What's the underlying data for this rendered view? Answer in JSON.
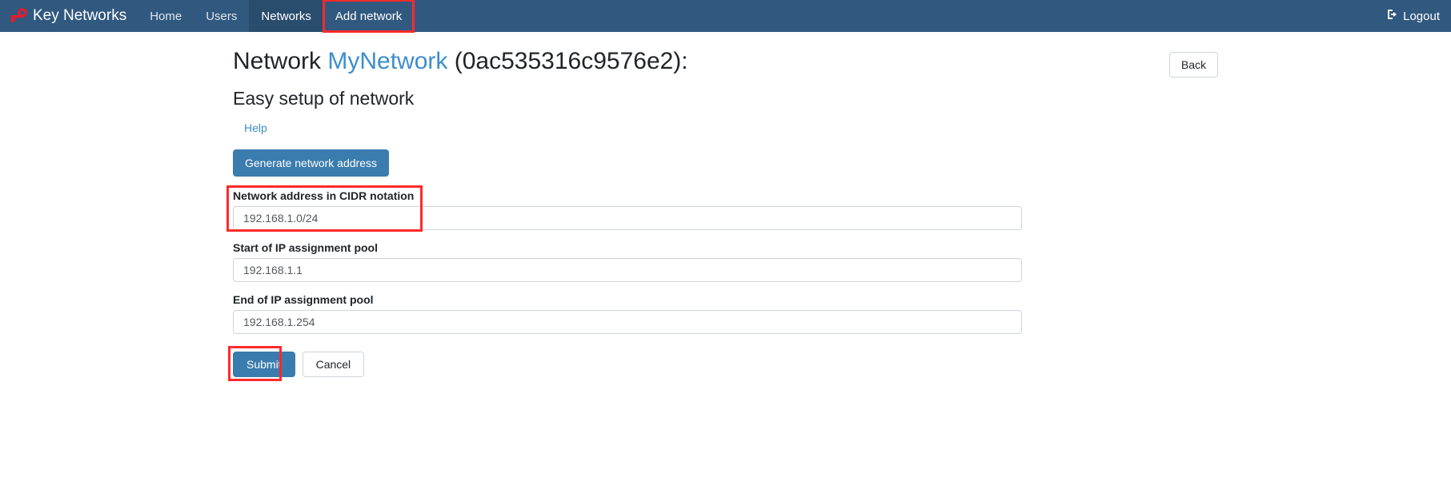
{
  "navbar": {
    "brand": "Key Networks",
    "brand_icon": "key-icon",
    "brand_icon_color": "#e8192c",
    "background_color": "#31597f",
    "active_background_color": "#2a4c6d",
    "links": [
      {
        "label": "Home",
        "state": "normal"
      },
      {
        "label": "Users",
        "state": "normal"
      },
      {
        "label": "Networks",
        "state": "active"
      },
      {
        "label": "Add network",
        "state": "highlighted"
      }
    ],
    "logout": {
      "label": "Logout",
      "icon": "sign-out-icon"
    }
  },
  "page": {
    "title_prefix": "Network",
    "network_name": "MyNetwork",
    "network_id": "(0ac535316c9576e2):",
    "subtitle": "Easy setup of network",
    "back_button": "Back",
    "help_link": "Help",
    "link_color": "#3d8ecc",
    "highlight_color": "#ff2a2a"
  },
  "form": {
    "generate_button": "Generate network address",
    "fields": [
      {
        "label": "Network address in CIDR notation",
        "value": "192.168.1.0/24",
        "placeholder": "192.168.1.0/24",
        "highlighted": true
      },
      {
        "label": "Start of IP assignment pool",
        "value": "192.168.1.1",
        "placeholder": "192.168.1.1",
        "highlighted": false
      },
      {
        "label": "End of IP assignment pool",
        "value": "192.168.1.254",
        "placeholder": "192.168.1.254",
        "highlighted": false
      }
    ],
    "submit_button": "Submit",
    "cancel_button": "Cancel"
  }
}
